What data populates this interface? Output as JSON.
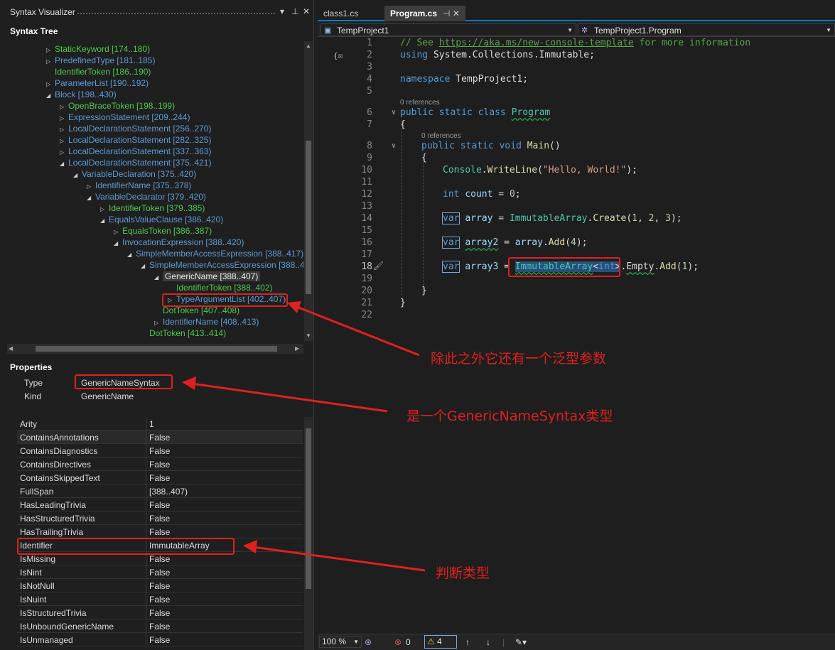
{
  "left_panel": {
    "title": "Syntax Visualizer",
    "title_controls": [
      "▾",
      "⊥",
      "✕"
    ],
    "tree_label": "Syntax Tree",
    "tree": [
      {
        "label": "StaticKeyword [174..180)",
        "kind": "token",
        "depth": 3,
        "arrow": "▷"
      },
      {
        "label": "PredefinedType [181..185)",
        "kind": "node",
        "depth": 3,
        "arrow": "▷"
      },
      {
        "label": "IdentifierToken [186..190)",
        "kind": "token",
        "depth": 3,
        "arrow": ""
      },
      {
        "label": "ParameterList [190..192)",
        "kind": "node",
        "depth": 3,
        "arrow": "▷"
      },
      {
        "label": "Block [198..430)",
        "kind": "node",
        "depth": 3,
        "arrow": "◢"
      },
      {
        "label": "OpenBraceToken [198..199)",
        "kind": "token",
        "depth": 4,
        "arrow": "▷"
      },
      {
        "label": "ExpressionStatement [209..244)",
        "kind": "node",
        "depth": 4,
        "arrow": "▷"
      },
      {
        "label": "LocalDeclarationStatement [256..270)",
        "kind": "node",
        "depth": 4,
        "arrow": "▷"
      },
      {
        "label": "LocalDeclarationStatement [282..325)",
        "kind": "node",
        "depth": 4,
        "arrow": "▷"
      },
      {
        "label": "LocalDeclarationStatement [337..363)",
        "kind": "node",
        "depth": 4,
        "arrow": "▷"
      },
      {
        "label": "LocalDeclarationStatement [375..421)",
        "kind": "node",
        "depth": 4,
        "arrow": "◢"
      },
      {
        "label": "VariableDeclaration [375..420)",
        "kind": "node",
        "depth": 5,
        "arrow": "◢"
      },
      {
        "label": "IdentifierName [375..378)",
        "kind": "node",
        "depth": 6,
        "arrow": "▷"
      },
      {
        "label": "VariableDeclarator [379..420)",
        "kind": "node",
        "depth": 6,
        "arrow": "◢"
      },
      {
        "label": "IdentifierToken [379..385)",
        "kind": "token",
        "depth": 7,
        "arrow": "▷"
      },
      {
        "label": "EqualsValueClause [386..420)",
        "kind": "node",
        "depth": 7,
        "arrow": "◢"
      },
      {
        "label": "EqualsToken [386..387)",
        "kind": "token",
        "depth": 8,
        "arrow": "▷"
      },
      {
        "label": "InvocationExpression [388..420)",
        "kind": "node",
        "depth": 8,
        "arrow": "◢"
      },
      {
        "label": "SimpleMemberAccessExpression [388..417)",
        "kind": "node",
        "depth": 9,
        "arrow": "◢"
      },
      {
        "label": "SimpleMemberAccessExpression [388..4",
        "kind": "node",
        "depth": 10,
        "arrow": "◢"
      },
      {
        "label": "GenericName [388..407)",
        "kind": "selected",
        "depth": 11,
        "arrow": "◢"
      },
      {
        "label": "IdentifierToken [388..402)",
        "kind": "token",
        "depth": 12,
        "arrow": ""
      },
      {
        "label": "TypeArgumentList [402..407)",
        "kind": "node",
        "depth": 12,
        "arrow": "▷"
      },
      {
        "label": "DotToken [407..408)",
        "kind": "token",
        "depth": 11,
        "arrow": ""
      },
      {
        "label": "IdentifierName [408..413)",
        "kind": "node",
        "depth": 11,
        "arrow": "▷"
      },
      {
        "label": "DotToken [413..414)",
        "kind": "token",
        "depth": 10,
        "arrow": ""
      }
    ],
    "properties_label": "Properties",
    "type_key": "Type",
    "type_value": "GenericNameSyntax",
    "kind_key": "Kind",
    "kind_value": "GenericName",
    "grid": [
      {
        "k": "Arity",
        "v": "1"
      },
      {
        "k": "ContainsAnnotations",
        "v": "False"
      },
      {
        "k": "ContainsDiagnostics",
        "v": "False"
      },
      {
        "k": "ContainsDirectives",
        "v": "False"
      },
      {
        "k": "ContainsSkippedText",
        "v": "False"
      },
      {
        "k": "FullSpan",
        "v": "[388..407)"
      },
      {
        "k": "HasLeadingTrivia",
        "v": "False"
      },
      {
        "k": "HasStructuredTrivia",
        "v": "False"
      },
      {
        "k": "HasTrailingTrivia",
        "v": "False"
      },
      {
        "k": "Identifier",
        "v": "ImmutableArray"
      },
      {
        "k": "IsMissing",
        "v": "False"
      },
      {
        "k": "IsNint",
        "v": "False"
      },
      {
        "k": "IsNotNull",
        "v": "False"
      },
      {
        "k": "IsNuint",
        "v": "False"
      },
      {
        "k": "IsStructuredTrivia",
        "v": "False"
      },
      {
        "k": "IsUnboundGenericName",
        "v": "False"
      },
      {
        "k": "IsUnmanaged",
        "v": "False"
      }
    ]
  },
  "editor": {
    "tabs": [
      {
        "label": "class1.cs"
      },
      {
        "label": "Program.cs",
        "icons": "⊣ ✕"
      }
    ],
    "nav_left": "TempProject1",
    "nav_right": "TempProject1.Program",
    "line_numbers": [
      "1",
      "2",
      "3",
      "4",
      "5",
      "6",
      "7",
      "8",
      "9",
      "10",
      "11",
      "12",
      "13",
      "14",
      "15",
      "16",
      "17",
      "18",
      "19",
      "20",
      "21",
      "22"
    ],
    "ref_text": "0 references",
    "code": {
      "l1_comment": "// See ",
      "l1_link": "https://aka.ms/new-console-template",
      "l1_tail": " for more information",
      "l2_using": "using",
      "l2_rest": " System.Collections.Immutable;",
      "l4_ns": "namespace",
      "l4_rest": " TempProject1;",
      "l6_pub": "public",
      "l6_static": "static",
      "l6_class": "class",
      "l6_name": "Program",
      "brace_open": "{",
      "brace_close": "}",
      "l8_void": "void",
      "l8_main": "Main",
      "l8_paren": "()",
      "l10_console": "Console",
      "l10_dot": ".",
      "l10_write": "WriteLine",
      "l10_open": "(",
      "l10_str": "\"Hello, World!\"",
      "l10_close": ");",
      "l12_int": "int",
      "l12_count": "count",
      "l12_rest": " = ",
      "l12_zero": "0",
      "semi": ";",
      "l14_var": "var",
      "l14_name": "array",
      "l14_eq": " = ",
      "l14_type": "ImmutableArray",
      "l14_create": "Create",
      "l14_args_open": "(",
      "n1": "1",
      "n2": "2",
      "n3": "3",
      "n4": "4",
      "comma": ", ",
      "close_semi": ");",
      "l16_name": "array2",
      "l16_add": "Add",
      "l18_name": "array3",
      "lt": "<",
      "gt": ">",
      "l18_empty": "Empty",
      "dot": "."
    },
    "status": {
      "zoom": "100 %",
      "errors": "0",
      "warnings": "4"
    }
  },
  "annotations": {
    "note1": "除此之外它还有一个泛型参数",
    "note2": "是一个GenericNameSyntax类型",
    "note3": "判断类型"
  },
  "colors": {
    "annotation_red": "#e02020",
    "accent_blue": "#007acc",
    "node_blue": "#5b9bd5",
    "token_green": "#4ec94e"
  }
}
